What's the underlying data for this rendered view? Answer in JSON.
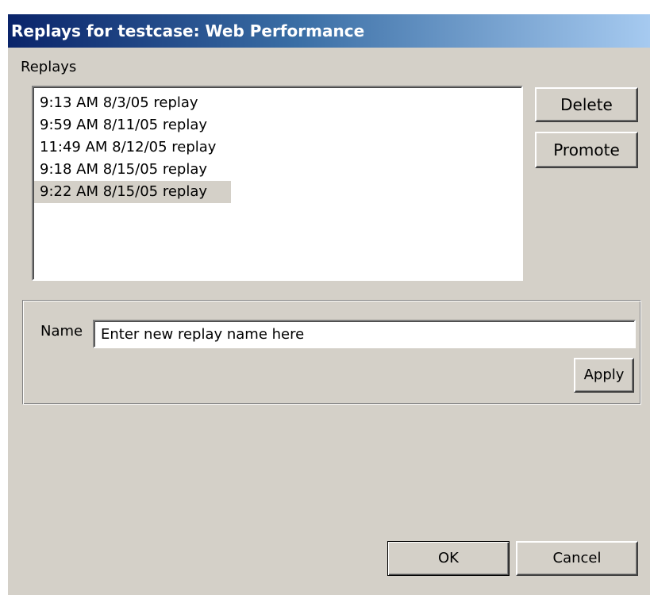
{
  "window": {
    "title": "Replays for testcase:  Web Performance"
  },
  "replays": {
    "section_label": "Replays",
    "items": [
      {
        "label": "9:13 AM 8/3/05 replay",
        "selected": false
      },
      {
        "label": "9:59 AM 8/11/05 replay",
        "selected": false
      },
      {
        "label": "11:49 AM 8/12/05 replay",
        "selected": false
      },
      {
        "label": "9:18 AM 8/15/05 replay",
        "selected": false
      },
      {
        "label": "9:22 AM 8/15/05 replay",
        "selected": true
      }
    ],
    "delete_label": "Delete",
    "promote_label": "Promote"
  },
  "rename": {
    "name_label": "Name",
    "input_value": "Enter new replay name here",
    "apply_label": "Apply"
  },
  "footer": {
    "ok_label": "OK",
    "cancel_label": "Cancel"
  },
  "colors": {
    "dialog_bg": "#d4d0c8",
    "title_gradient_start": "#0a246a",
    "title_gradient_end": "#a6caf0",
    "title_text": "#ffffff"
  }
}
